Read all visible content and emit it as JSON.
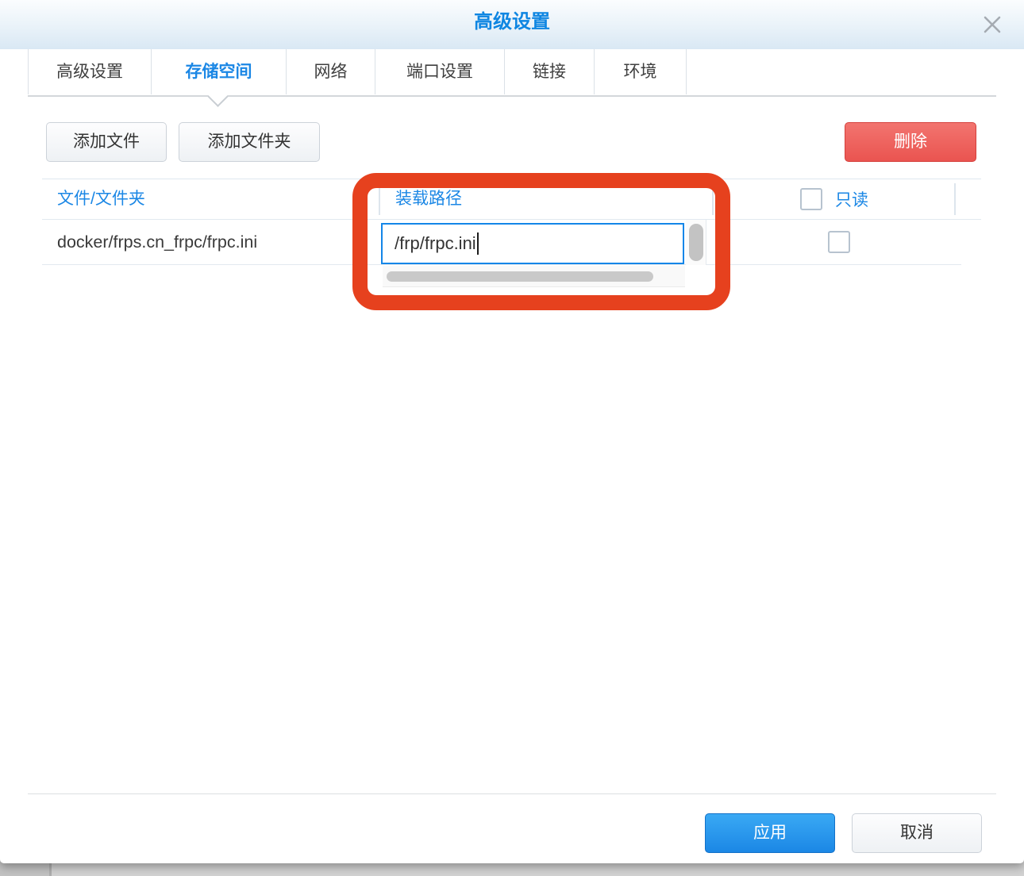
{
  "window": {
    "title": "高级设置"
  },
  "tabs": [
    {
      "label": "高级设置",
      "active": false
    },
    {
      "label": "存储空间",
      "active": true
    },
    {
      "label": "网络",
      "active": false
    },
    {
      "label": "端口设置",
      "active": false
    },
    {
      "label": "链接",
      "active": false
    },
    {
      "label": "环境",
      "active": false
    }
  ],
  "toolbar": {
    "add_file_label": "添加文件",
    "add_folder_label": "添加文件夹",
    "delete_label": "删除"
  },
  "table": {
    "headers": {
      "file": "文件/文件夹",
      "mount": "装载路径",
      "readonly": "只读"
    },
    "header_readonly_checked": false,
    "rows": [
      {
        "file": "docker/frps.cn_frpc/frpc.ini",
        "mount_path": "/frp/frpc.ini",
        "readonly": false
      }
    ]
  },
  "footer": {
    "apply_label": "应用",
    "cancel_label": "取消"
  },
  "annotation": {
    "shape": "rounded-rectangle",
    "color": "#e6411e",
    "highlights": "装载路径 column editor"
  },
  "colors": {
    "accent_blue": "#1b87e5",
    "danger_red": "#ed615d",
    "input_focus_border": "#1486e8"
  }
}
